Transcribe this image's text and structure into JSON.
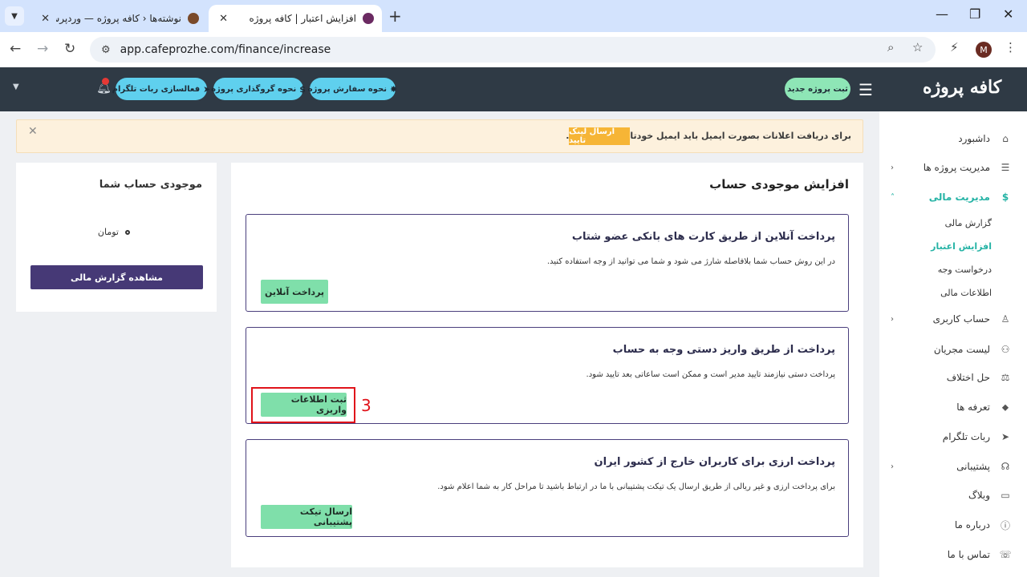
{
  "browser": {
    "tabs": [
      {
        "title": "نوشته‌ها ‹ کافه پروژه — وردپرس",
        "active": false
      },
      {
        "title": "افزایش اعتبار | کافه پروژه",
        "active": true
      }
    ],
    "url": "app.cafeprozhe.com/finance/increase",
    "profile_initial": "M"
  },
  "header": {
    "logo": "کافه پروژه",
    "new_project": "ثبت پروژه جدید",
    "how_to_order": "نحوه سفارش پروژه",
    "how_to_deposit": "نحوه گروگذاری پروژه",
    "telegram_bot": "فعالسازی ربات تلگرام",
    "notification_count": "1"
  },
  "alert": {
    "text": "برای دریافت اعلانات بصورت ایمیل باید ایمیل خودتان را تایید کنید.",
    "button": "ارسال لینک تایید"
  },
  "sidebar": {
    "items": [
      {
        "label": "داشبورد",
        "icon": "home-icon"
      },
      {
        "label": "مدیریت پروژه ها",
        "icon": "list-icon"
      },
      {
        "label": "مدیریت مالی",
        "icon": "dollar-icon"
      },
      {
        "label": "حساب کاربری",
        "icon": "user-icon"
      },
      {
        "label": "لیست مجریان",
        "icon": "users-icon"
      },
      {
        "label": "حل اختلاف",
        "icon": "scale-icon"
      },
      {
        "label": "تعرفه ها",
        "icon": "tag-icon"
      },
      {
        "label": "ربات تلگرام",
        "icon": "telegram-icon"
      },
      {
        "label": "پشتیبانی",
        "icon": "headset-icon"
      },
      {
        "label": "وبلاگ",
        "icon": "book-icon"
      },
      {
        "label": "درباره ما",
        "icon": "info-icon"
      },
      {
        "label": "تماس با ما",
        "icon": "phone-icon"
      }
    ],
    "finance_sub": [
      {
        "label": "گزارش مالی"
      },
      {
        "label": "افزایش اعتبار"
      },
      {
        "label": "درخواست وجه"
      },
      {
        "label": "اطلاعات مالی"
      }
    ]
  },
  "main": {
    "title": "افزایش موجودی حساب",
    "methods": [
      {
        "title": "پرداخت آنلاین از طریق کارت های بانکی عضو شتاب",
        "desc": "در این روش حساب شما بلافاصله شارژ می شود و شما می توانید از وجه استفاده کنید.",
        "button": "پرداخت آنلاین"
      },
      {
        "title": "پرداخت از طریق واریز دستی وجه به حساب",
        "desc": "پرداخت دستی نیازمند تایید مدیر است و ممکن است ساعاتی بعد تایید شود.",
        "button": "ثبت اطلاعات واریزی"
      },
      {
        "title": "پرداخت ارزی برای کاربران خارج از کشور ایران",
        "desc": "برای پرداخت ارزی و غیر ریالی از طریق ارسال یک تیکت پشتیبانی با ما در ارتباط باشید تا مراحل کار به شما اعلام شود.",
        "button": "ارسال تیکت پشتیبانی"
      }
    ],
    "step_label": "3"
  },
  "balance": {
    "title": "موجودی حساب شما",
    "currency": "تومان",
    "report_button": "مشاهده گزارش مالی"
  },
  "colors": {
    "accent": "#25b3a5",
    "header_bg": "#2f3a45",
    "button_green": "#7fdfaa",
    "button_purple": "#463976",
    "highlight": "#e0131a"
  }
}
